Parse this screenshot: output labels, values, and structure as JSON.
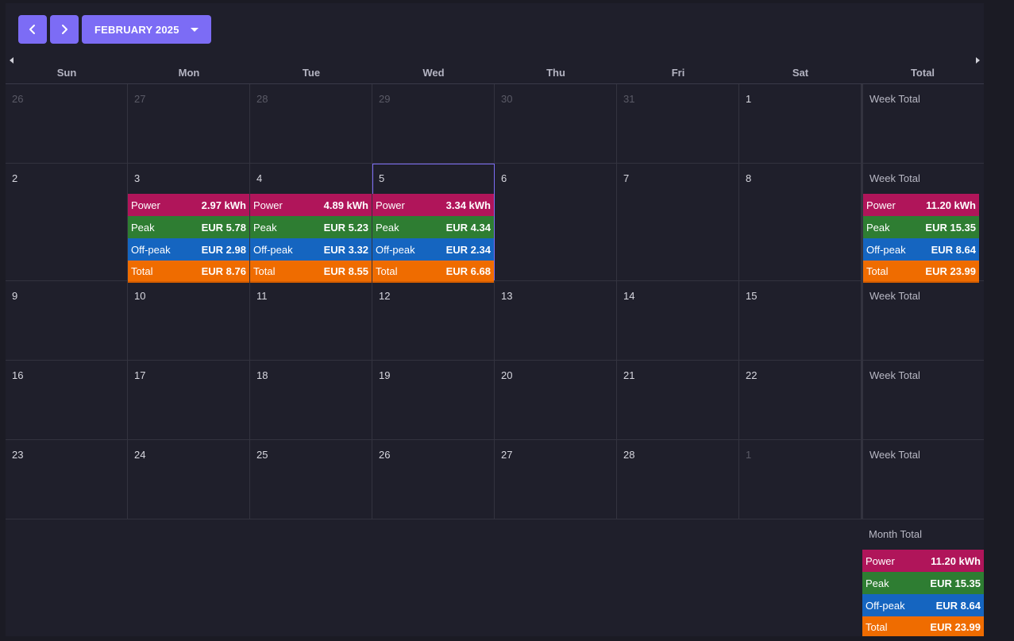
{
  "toolbar": {
    "prev_icon": "chevron-left-icon",
    "next_icon": "chevron-right-icon",
    "month_label": "FEBRUARY 2025"
  },
  "headers": [
    "Sun",
    "Mon",
    "Tue",
    "Wed",
    "Thu",
    "Fri",
    "Sat",
    "Total"
  ],
  "week_total_label": "Week Total",
  "month_total_label": "Month Total",
  "stat_labels": {
    "power": "Power",
    "peak": "Peak",
    "offpeak": "Off-peak",
    "total": "Total"
  },
  "weeks": [
    {
      "days": [
        {
          "n": "26",
          "muted": true
        },
        {
          "n": "27",
          "muted": true
        },
        {
          "n": "28",
          "muted": true
        },
        {
          "n": "29",
          "muted": true
        },
        {
          "n": "30",
          "muted": true
        },
        {
          "n": "31",
          "muted": true
        },
        {
          "n": "1",
          "muted": false
        }
      ],
      "total": null
    },
    {
      "days": [
        {
          "n": "2",
          "muted": false
        },
        {
          "n": "3",
          "muted": false,
          "stats": {
            "power": "2.97 kWh",
            "peak": "EUR 5.78",
            "offpeak": "EUR 2.98",
            "total": "EUR 8.76"
          }
        },
        {
          "n": "4",
          "muted": false,
          "stats": {
            "power": "4.89 kWh",
            "peak": "EUR 5.23",
            "offpeak": "EUR 3.32",
            "total": "EUR 8.55"
          }
        },
        {
          "n": "5",
          "muted": false,
          "today": true,
          "stats": {
            "power": "3.34 kWh",
            "peak": "EUR 4.34",
            "offpeak": "EUR 2.34",
            "total": "EUR 6.68"
          }
        },
        {
          "n": "6",
          "muted": false
        },
        {
          "n": "7",
          "muted": false
        },
        {
          "n": "8",
          "muted": false
        }
      ],
      "total": {
        "power": "11.20 kWh",
        "peak": "EUR 15.35",
        "offpeak": "EUR 8.64",
        "total": "EUR 23.99"
      }
    },
    {
      "days": [
        {
          "n": "9",
          "muted": false
        },
        {
          "n": "10",
          "muted": false
        },
        {
          "n": "11",
          "muted": false
        },
        {
          "n": "12",
          "muted": false
        },
        {
          "n": "13",
          "muted": false
        },
        {
          "n": "14",
          "muted": false
        },
        {
          "n": "15",
          "muted": false
        }
      ],
      "total": null
    },
    {
      "days": [
        {
          "n": "16",
          "muted": false
        },
        {
          "n": "17",
          "muted": false
        },
        {
          "n": "18",
          "muted": false
        },
        {
          "n": "19",
          "muted": false
        },
        {
          "n": "20",
          "muted": false
        },
        {
          "n": "21",
          "muted": false
        },
        {
          "n": "22",
          "muted": false
        }
      ],
      "total": null
    },
    {
      "days": [
        {
          "n": "23",
          "muted": false
        },
        {
          "n": "24",
          "muted": false
        },
        {
          "n": "25",
          "muted": false
        },
        {
          "n": "26",
          "muted": false
        },
        {
          "n": "27",
          "muted": false
        },
        {
          "n": "28",
          "muted": false
        },
        {
          "n": "1",
          "muted": true
        }
      ],
      "total": null
    }
  ],
  "month_total": {
    "power": "11.20 kWh",
    "peak": "EUR 15.35",
    "offpeak": "EUR 8.64",
    "total": "EUR 23.99"
  },
  "colors": {
    "accent": "#7c6cf5",
    "power": "#b0155a",
    "peak": "#2e7d32",
    "offpeak": "#1565c0",
    "total": "#ef6c00"
  }
}
